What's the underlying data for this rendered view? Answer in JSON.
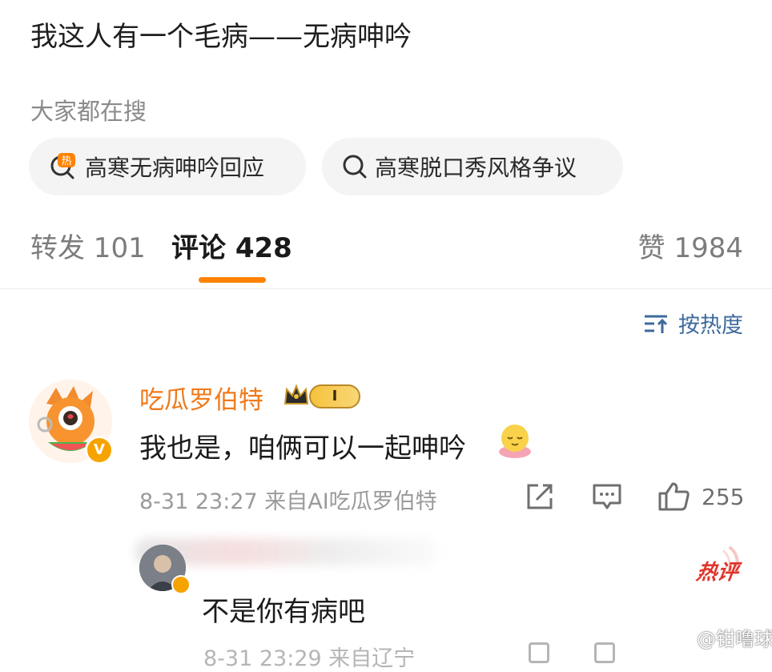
{
  "post": {
    "text": "我这人有一个毛病——无病呻吟"
  },
  "search": {
    "title": "大家都在搜",
    "chips": [
      {
        "label": "高寒无病呻吟回应",
        "icon": "hot-search-icon",
        "badge": "热"
      },
      {
        "label": "高寒脱口秀风格争议",
        "icon": "search-icon"
      }
    ]
  },
  "tabs": {
    "repost": "转发 101",
    "comment": "评论 428",
    "like": "赞 1984"
  },
  "sort": {
    "label": "按热度",
    "icon": "sort-icon"
  },
  "comment": {
    "username": "吃瓜罗伯特",
    "level": "I",
    "verified_badge": "V",
    "text": "我也是，咱俩可以一起呻吟",
    "meta": "8-31 23:27  来自AI吃瓜罗伯特",
    "like_count": "255"
  },
  "reply": {
    "badge": "热评",
    "text": "不是你有病吧",
    "meta_partial": "8-31 23:29  来自辽宁"
  },
  "watermark": {
    "text": "@钳噜球"
  },
  "colors": {
    "accent_orange": "#ff8200",
    "username_orange": "#f07a1a",
    "link_blue": "#3d6a9d",
    "hot_red": "#e0342b"
  }
}
